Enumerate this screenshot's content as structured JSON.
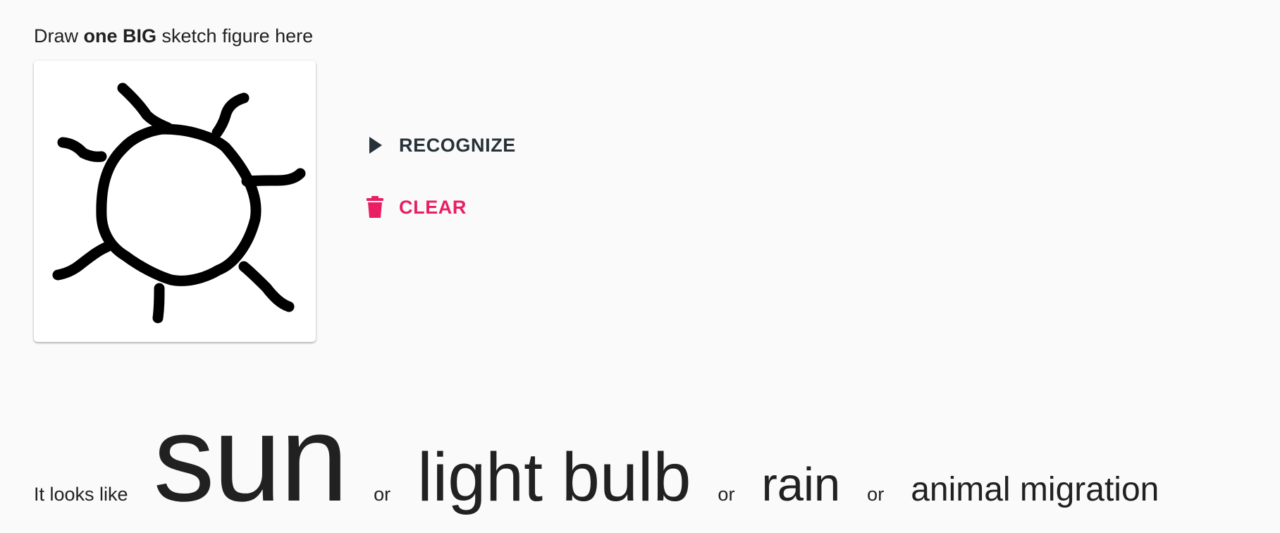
{
  "instruction": {
    "prefix": "Draw ",
    "emphasis": "one BIG",
    "suffix": " sketch figure here"
  },
  "canvas": {
    "stroke_color": "#000000",
    "background": "#ffffff"
  },
  "actions": {
    "recognize": {
      "label": "RECOGNIZE",
      "icon": "play-arrow-icon",
      "color": "#263238"
    },
    "clear": {
      "label": "CLEAR",
      "icon": "trash-icon",
      "color": "#e91e63"
    }
  },
  "results": {
    "prefix": "It looks like",
    "separator": "or",
    "guesses": [
      "sun",
      "light bulb",
      "rain",
      "animal migration"
    ]
  }
}
